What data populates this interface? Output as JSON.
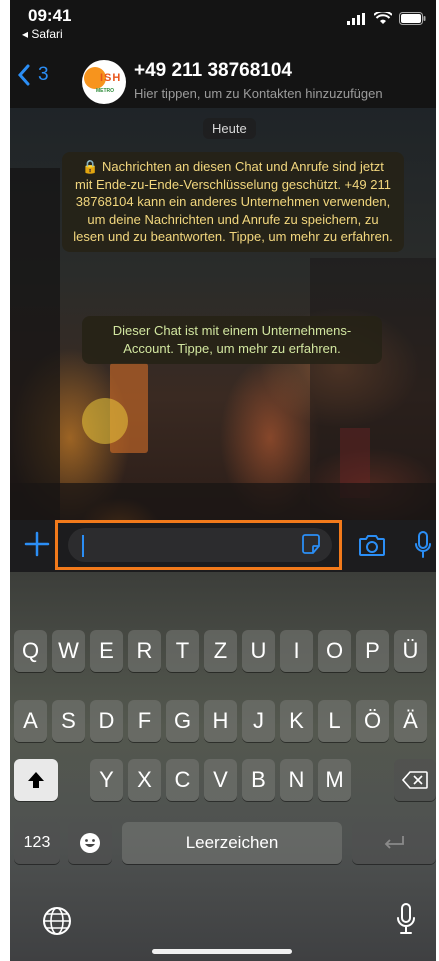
{
  "status_bar": {
    "time": "09:41",
    "back_app": "◂ Safari"
  },
  "header": {
    "back_count": "3",
    "avatar_text": "ISH",
    "avatar_sub": "METRO",
    "contact_name": "+49 211 38768104",
    "contact_subtitle": "Hier tippen, um zu Kontakten hinzuzufügen"
  },
  "chat": {
    "date_label": "Heute",
    "encryption_notice": "🔒 Nachrichten an diesen Chat und Anrufe sind jetzt mit Ende-zu-Ende-Verschlüsselung geschützt. +49 211 38768104 kann ein anderes Unternehmen verwenden, um deine Nachrichten und Anrufe zu speichern, zu lesen und zu beantworten. Tippe, um mehr zu erfahren.",
    "business_notice": "Dieser Chat ist mit einem Unternehmens-Account. Tippe, um mehr zu erfahren."
  },
  "input": {
    "value": "",
    "placeholder": ""
  },
  "keyboard": {
    "row1": [
      "Q",
      "W",
      "E",
      "R",
      "T",
      "Z",
      "U",
      "I",
      "O",
      "P",
      "Ü"
    ],
    "row2": [
      "A",
      "S",
      "D",
      "F",
      "G",
      "H",
      "J",
      "K",
      "L",
      "Ö",
      "Ä"
    ],
    "row3": [
      "Y",
      "X",
      "C",
      "V",
      "B",
      "N",
      "M"
    ],
    "numbers_key": "123",
    "space_label": "Leerzeichen"
  },
  "colors": {
    "accent": "#2b8ef5",
    "highlight": "#f27a1b",
    "system_text": "#f2d77e",
    "business_text": "#d2e6a0"
  }
}
